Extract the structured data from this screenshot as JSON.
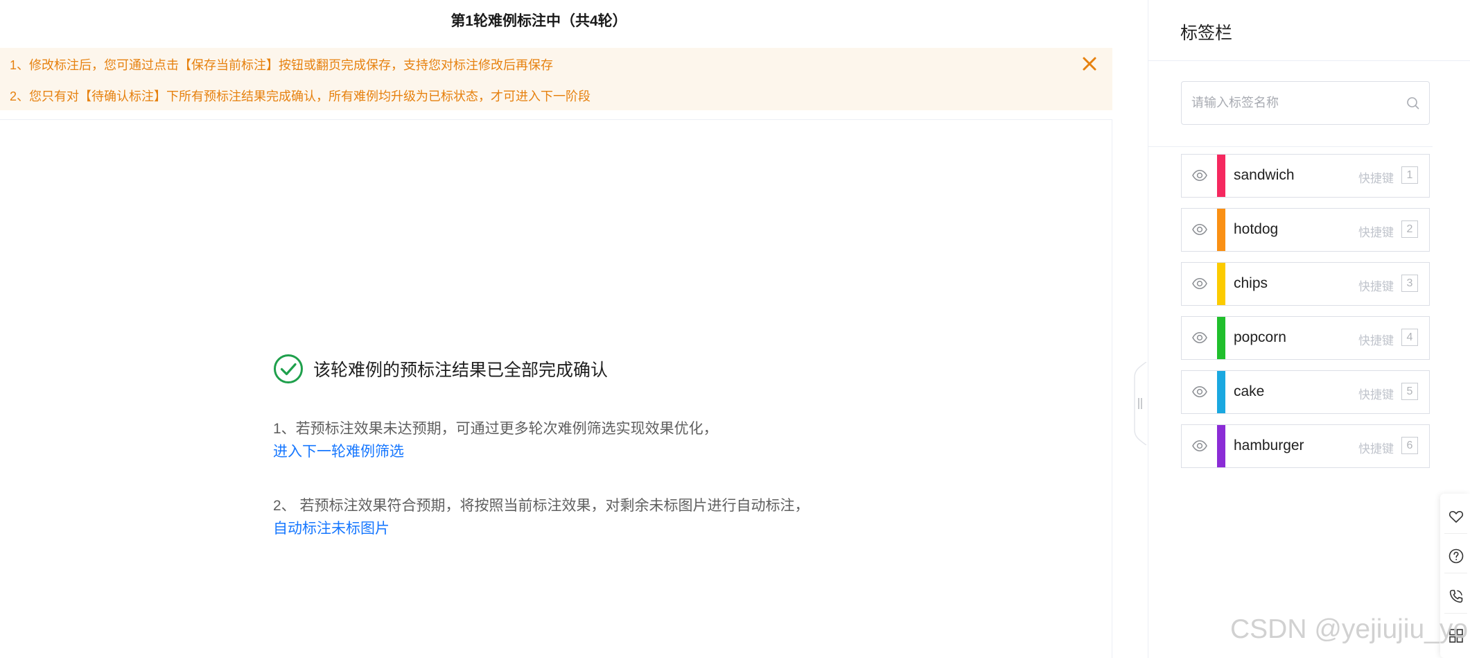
{
  "main": {
    "title": "第1轮难例标注中（共4轮）",
    "notices": [
      "1、修改标注后，您可通过点击【保存当前标注】按钮或翻页完成保存，支持您对标注修改后再保存",
      "2、您只有对【待确认标注】下所有预标注结果完成确认，所有难例均升级为已标状态，才可进入下一阶段"
    ],
    "close_icon": "close-icon",
    "done_icon": "check-circle-icon",
    "done_message": "该轮难例的预标注结果已全部完成确认",
    "step1_text": "1、若预标注效果未达预期，可通过更多轮次难例筛选实现效果优化，",
    "step1_link": "进入下一轮难例筛选",
    "step2_text": "2、 若预标注效果符合预期，将按照当前标注效果，对剩余未标图片进行自动标注，",
    "step2_link": "自动标注未标图片",
    "colors": {
      "notice_bg": "#fdf6ec",
      "notice_text": "#e6810f",
      "link": "#1677ff",
      "success": "#1fa04c"
    }
  },
  "sidebar": {
    "title": "标签栏",
    "search_placeholder": "请输入标签名称",
    "search_value": "",
    "search_icon": "search-icon",
    "shortcut_label": "快捷键",
    "labels": [
      {
        "name": "sandwich",
        "color": "#f5285f",
        "key": "1",
        "icon": "eye-icon"
      },
      {
        "name": "hotdog",
        "color": "#fa9014",
        "key": "2",
        "icon": "eye-icon"
      },
      {
        "name": "chips",
        "color": "#fccb00",
        "key": "3",
        "icon": "eye-icon"
      },
      {
        "name": "popcorn",
        "color": "#20bf2c",
        "key": "4",
        "icon": "eye-icon"
      },
      {
        "name": "cake",
        "color": "#1aa8e0",
        "key": "5",
        "icon": "eye-icon"
      },
      {
        "name": "hamburger",
        "color": "#8b2cd6",
        "key": "6",
        "icon": "eye-icon"
      }
    ]
  },
  "floatbar": {
    "icons": [
      "heart-icon",
      "help-icon",
      "phone-icon",
      "grid-icon"
    ]
  },
  "watermark": "CSDN @yejiujiu_yo"
}
